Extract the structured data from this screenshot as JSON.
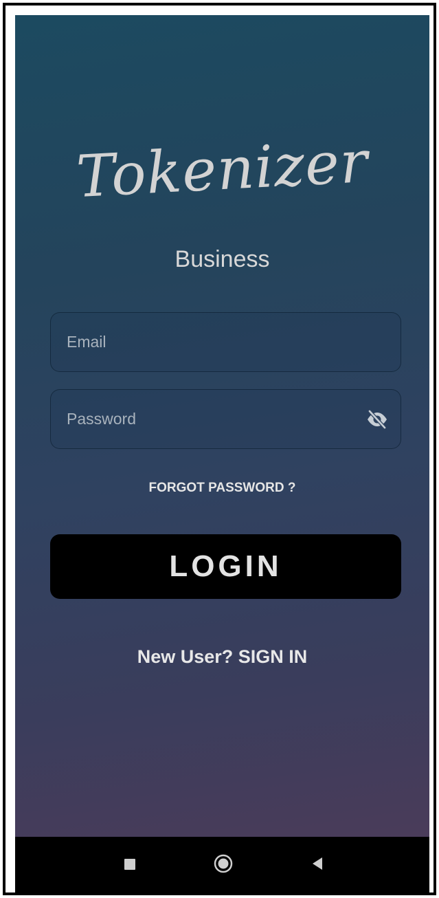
{
  "app": {
    "logo_text": "Tokenizer",
    "subtitle": "Business"
  },
  "form": {
    "email": {
      "placeholder": "Email",
      "value": ""
    },
    "password": {
      "placeholder": "Password",
      "value": "",
      "toggle_icon": "eye-off-icon"
    },
    "forgot_label": "FORGOT PASSWORD ?",
    "login_label": "LOGIN",
    "signup_label": "New User? SIGN IN"
  },
  "navbar": {
    "icons": [
      "recents-icon",
      "home-icon",
      "back-icon"
    ]
  },
  "colors": {
    "gradient_top": "#1c4a60",
    "gradient_bottom": "#4a3c5a",
    "button_bg": "#000000",
    "text_light": "#e3e3e3"
  }
}
